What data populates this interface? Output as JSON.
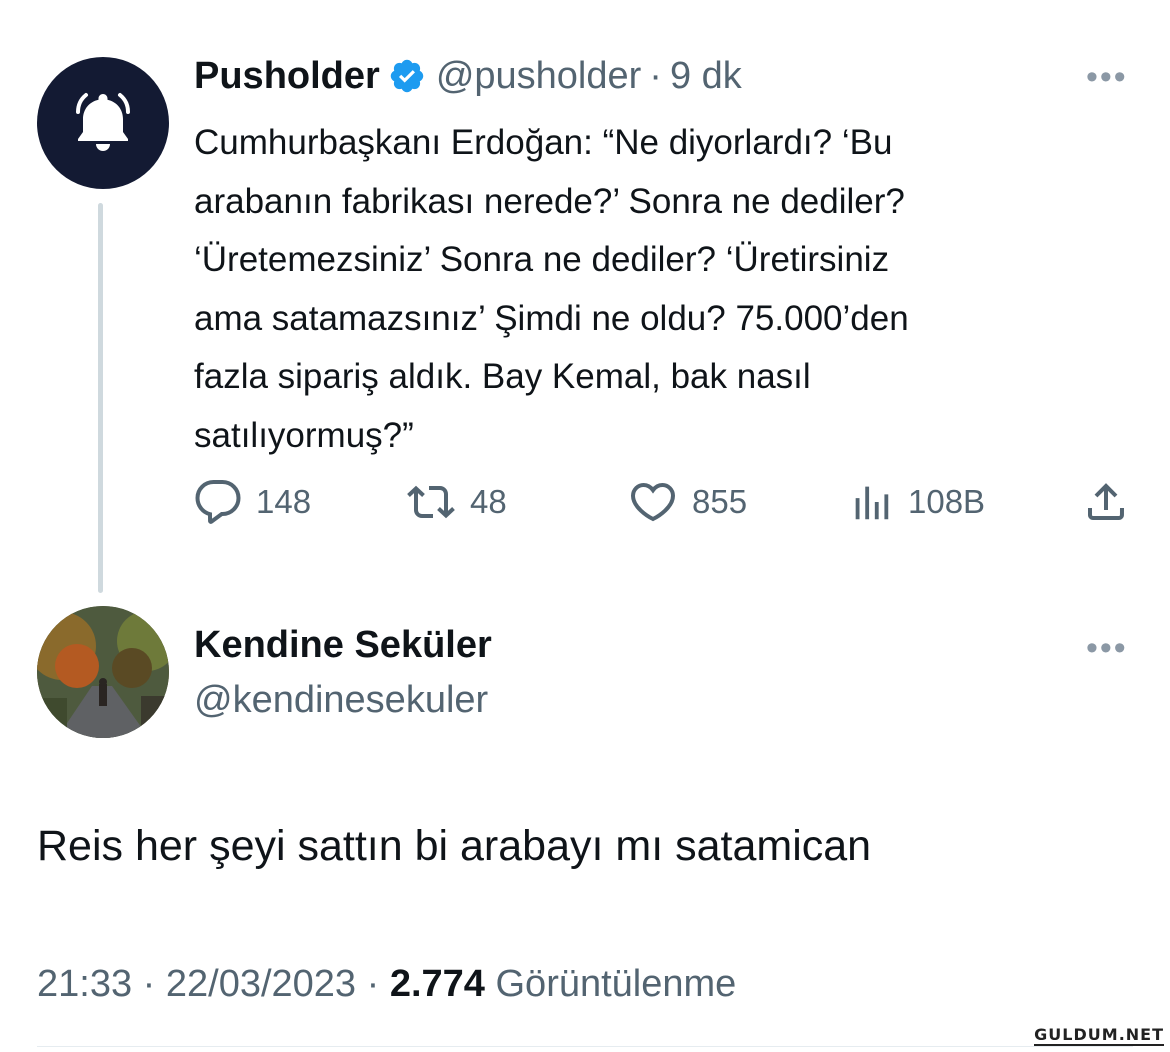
{
  "tweet": {
    "author_name": "Pusholder",
    "author_handle": "@pusholder",
    "separator": "·",
    "time_ago": "9 dk",
    "text": "Cumhurbaşkanı Erdoğan: “Ne diyorlardı? ‘Bu\narabanın fabrikası nerede?’ Sonra ne dediler?\n‘Üretemezsiniz’ Sonra ne dediler? ‘Üretirsiniz\nama satamazsınız’ Şimdi ne oldu? 75.000’den\nfazla sipariş aldık. Bay Kemal, bak nasıl\nsatılıyormuş?”",
    "more_label": "•••",
    "stats": {
      "replies": "148",
      "retweets": "48",
      "likes": "855",
      "views": "108B"
    }
  },
  "reply": {
    "author_name": "Kendine Seküler",
    "author_handle": "@kendinesekuler",
    "more_label": "•••",
    "text": "Reis her şeyi sattın bi arabayı mı satamican",
    "time": "21:33",
    "date": "22/03/2023",
    "separator": "·",
    "views_count": "2.774",
    "views_label": "Görüntülenme"
  },
  "watermark": "GULDUM.NET",
  "colors": {
    "text": "#0f1419",
    "secondary": "#536471",
    "verified": "#1d9bf0",
    "avatar_bg": "#131a33",
    "thread_line": "#cfd9de"
  },
  "icons": [
    "bell-icon",
    "verified-badge-icon",
    "reply-icon",
    "retweet-icon",
    "like-icon",
    "views-icon",
    "share-icon",
    "more-icon"
  ]
}
